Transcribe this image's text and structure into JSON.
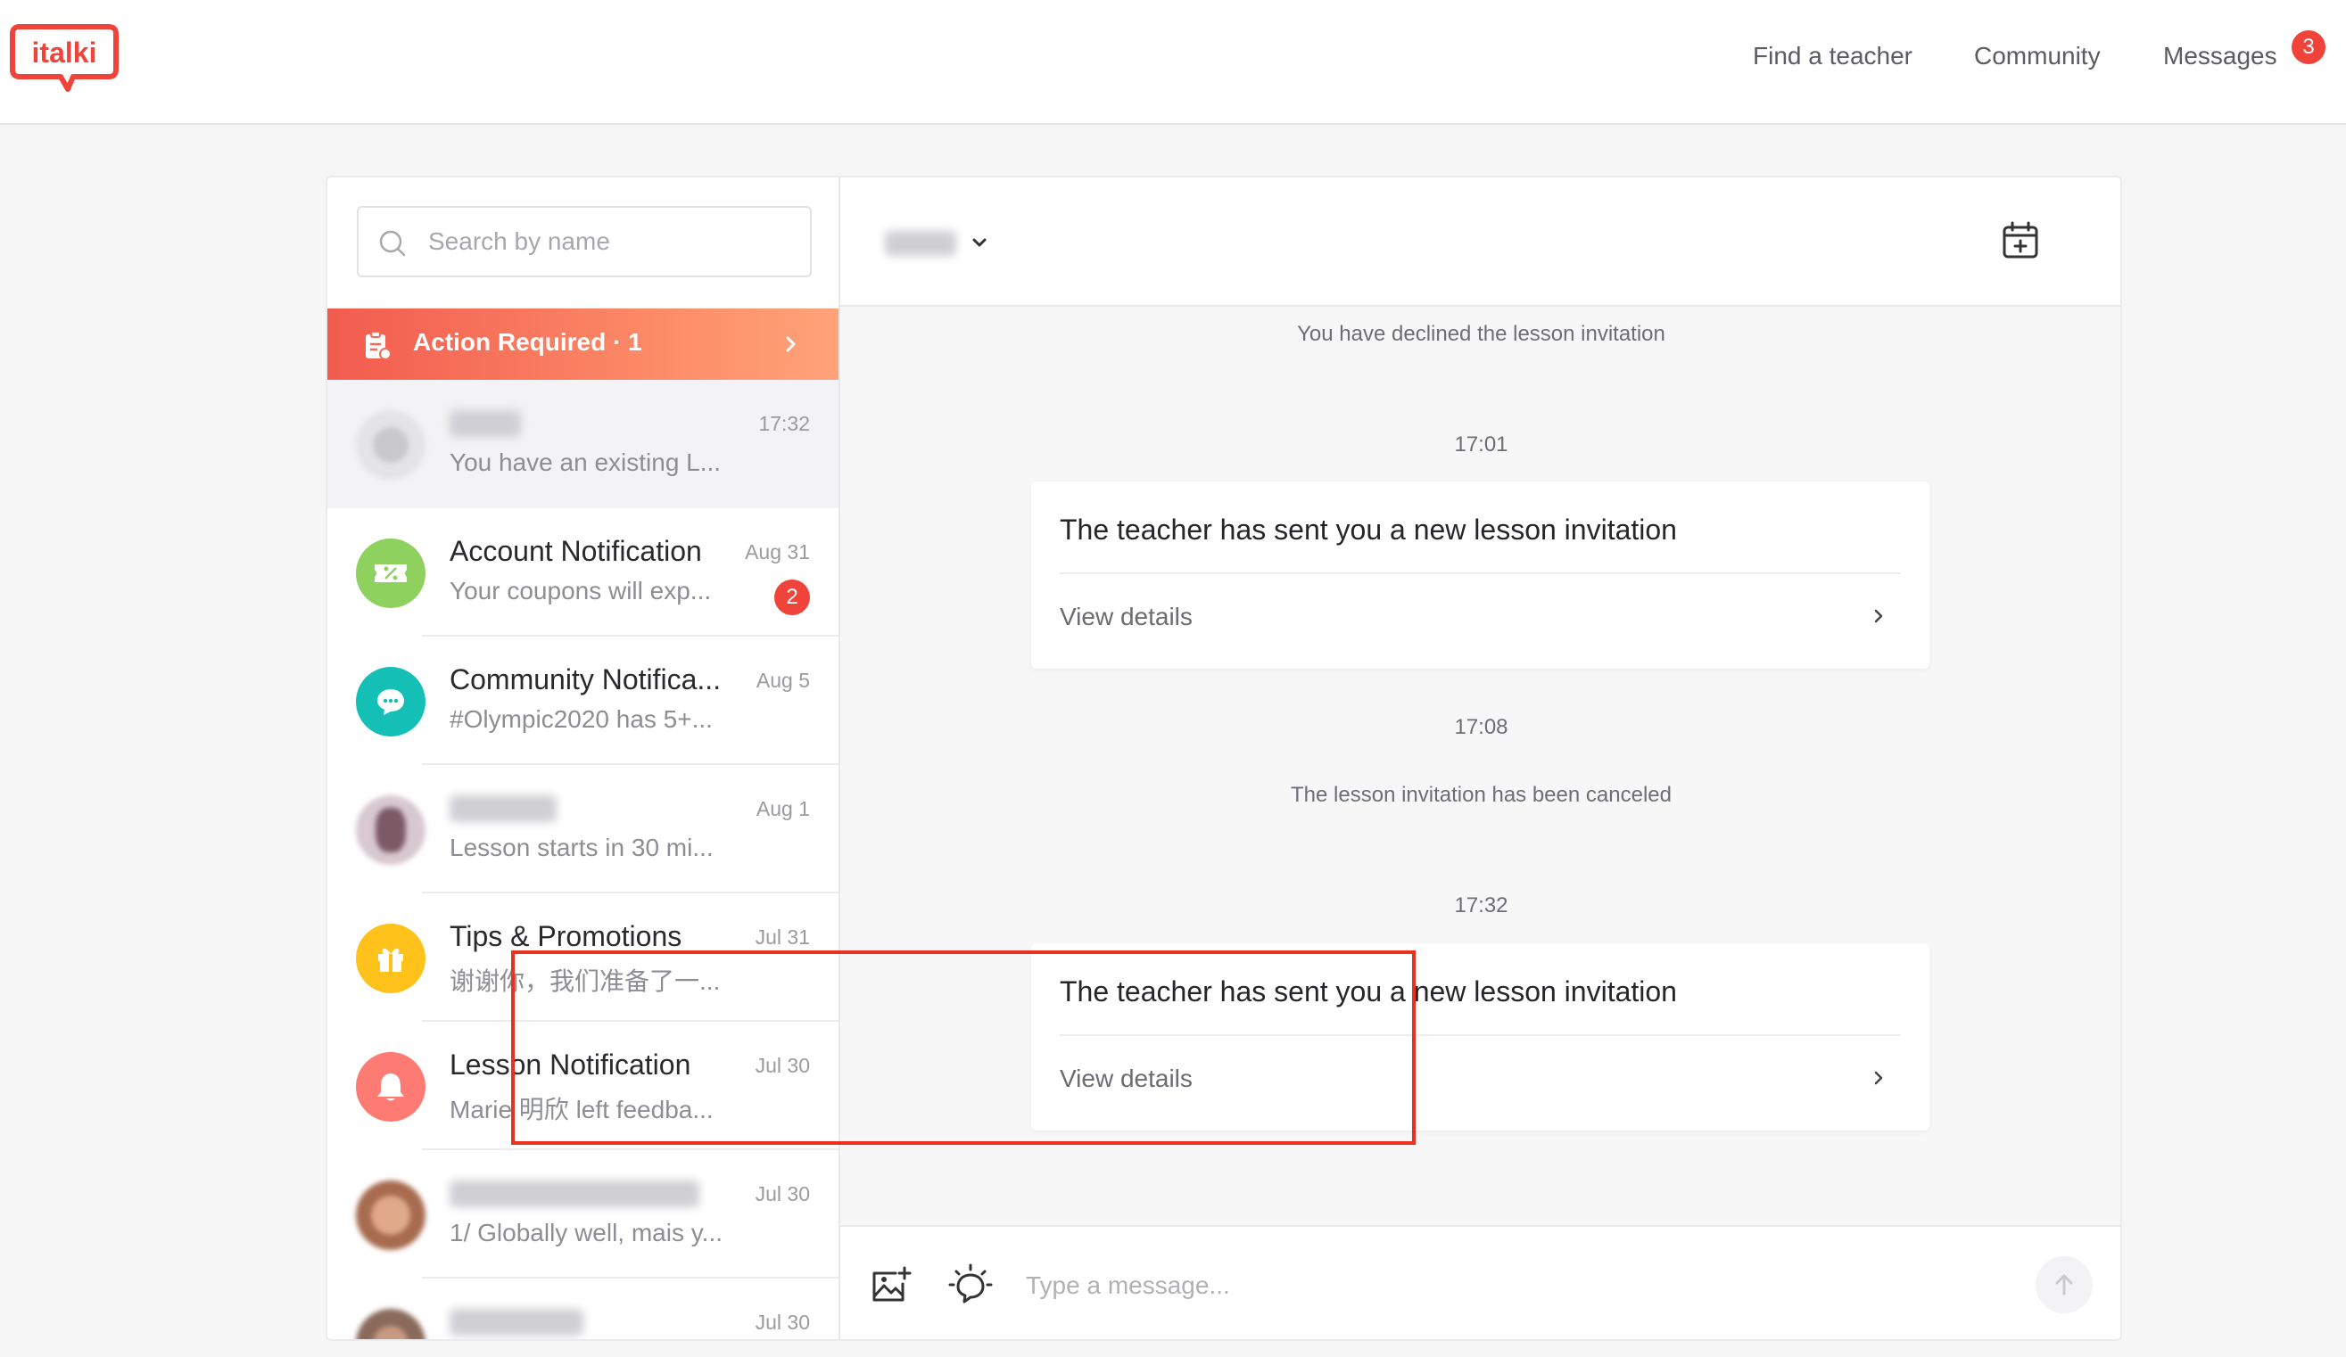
{
  "brand": {
    "logo_text": "italki",
    "accent": "#f0433a"
  },
  "nav": {
    "find_teacher": "Find a teacher",
    "community": "Community",
    "messages": "Messages",
    "messages_badge": "3"
  },
  "sidebar": {
    "search_placeholder": "Search by name",
    "action_required": "Action Required · 1",
    "conversations": [
      {
        "name": "",
        "preview": "You have an existing L...",
        "time": "17:32",
        "avatar": "blurred-photo",
        "active": true
      },
      {
        "name": "Account Notification",
        "preview": "Your coupons will exp...",
        "time": "Aug 31",
        "avatar": "coupon-icon",
        "color": "#8fd15f",
        "unread": "2"
      },
      {
        "name": "Community Notifica...",
        "preview": "#Olympic2020 has 5+...",
        "time": "Aug 5",
        "avatar": "chat-bubble-icon",
        "color": "#14bfb6"
      },
      {
        "name": "",
        "preview": "Lesson starts in 30 mi...",
        "time": "Aug 1",
        "avatar": "blurred-photo"
      },
      {
        "name": "Tips & Promotions",
        "preview": "谢谢你，我们准备了一...",
        "time": "Jul 31",
        "avatar": "gift-icon",
        "color": "#ffc21a"
      },
      {
        "name": "Lesson Notification",
        "preview": "Marie 明欣 left feedba...",
        "time": "Jul 30",
        "avatar": "bell-icon",
        "color": "#fd7b72"
      },
      {
        "name": "",
        "preview": "1/ Globally well, mais y...",
        "time": "Jul 30",
        "avatar": "blurred-photo"
      },
      {
        "name": "",
        "preview": "",
        "time": "Jul 30",
        "avatar": "blurred-photo"
      }
    ]
  },
  "chat": {
    "messages": {
      "declined": "You have declined the lesson invitation",
      "time_1": "17:01",
      "invite_1_title": "The teacher has sent you a new lesson invitation",
      "invite_1_link": "View details",
      "time_2": "17:08",
      "canceled": "The lesson invitation has been canceled",
      "time_3": "17:32",
      "invite_2_title": "The teacher has sent you a new lesson invitation",
      "invite_2_link": "View details"
    },
    "composer_placeholder": "Type a message..."
  }
}
